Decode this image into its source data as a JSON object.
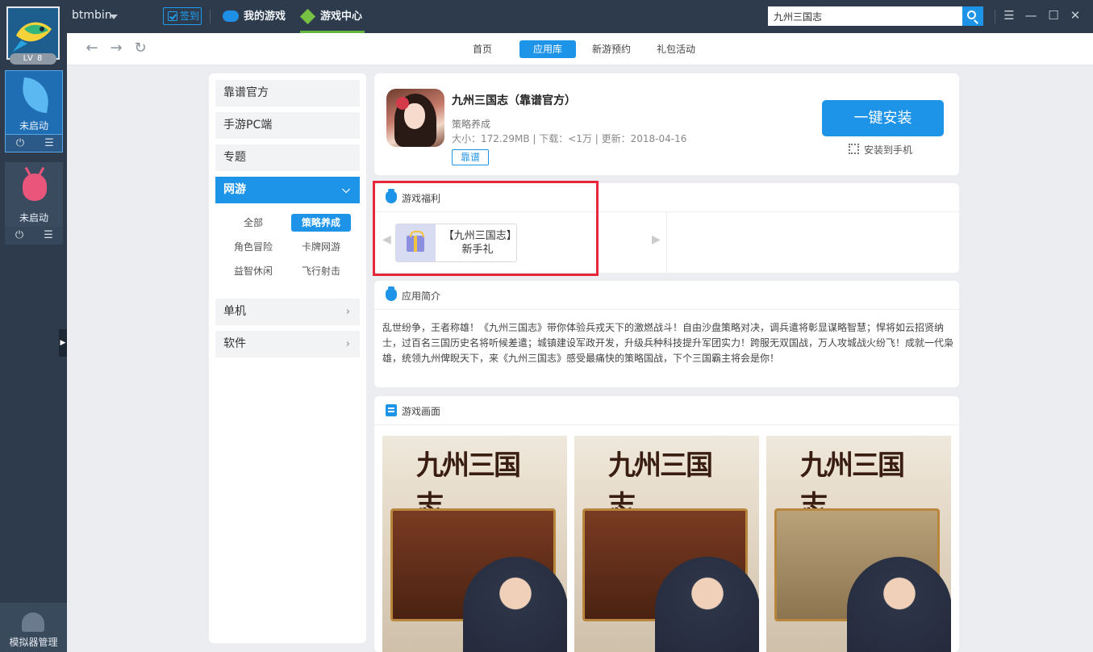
{
  "topbar": {
    "user": "btmbin",
    "level": "LV 8",
    "checkin": "签到",
    "nav_mygames": "我的游戏",
    "nav_center": "游戏中心",
    "search_value": "九州三国志",
    "accent": "#1e94e8"
  },
  "dock": {
    "emulators": [
      {
        "status": "未启动",
        "icon": "leaf-icon"
      },
      {
        "status": "未启动",
        "icon": "bug-icon"
      }
    ],
    "manager": "模拟器管理"
  },
  "browser": {
    "tabs": [
      "首页",
      "应用库",
      "新游预约",
      "礼包活动"
    ],
    "active_tab": "应用库"
  },
  "categories": {
    "top": [
      "靠谱官方",
      "手游PC端",
      "专题"
    ],
    "active": "网游",
    "sub": [
      "全部",
      "策略养成",
      "角色冒险",
      "卡牌网游",
      "益智休闲",
      "飞行射击"
    ],
    "active_sub": "策略养成",
    "bottom": [
      "单机",
      "软件"
    ]
  },
  "app": {
    "title": "九州三国志（靠谱官方）",
    "genre": "策略养成",
    "meta": "大小：172.29MB | 下载：<1万 | 更新：2018-04-16",
    "tag": "靠谱",
    "install": "一键安装",
    "install_phone": "安装到手机"
  },
  "welfare": {
    "title": "游戏福利",
    "gift": "【九州三国志】新手礼"
  },
  "intro": {
    "title": "应用简介",
    "text": "乱世纷争，王者称雄！《九州三国志》带你体验兵戎天下的激燃战斗！自由沙盘策略对决，调兵遣将彰显谋略智慧；悍将如云招贤纳士，过百名三国历史名将听候差遣；城镇建设军政开发，升级兵种科技提升军团实力！跨服无双国战，万人攻城战火纷飞！成就一代枭雄，统领九州俾睨天下，来《九州三国志》感受最痛快的策略国战，下个三国霸主将会是你！"
  },
  "screens": {
    "title": "游戏画面",
    "art_title": "九州三国志"
  }
}
